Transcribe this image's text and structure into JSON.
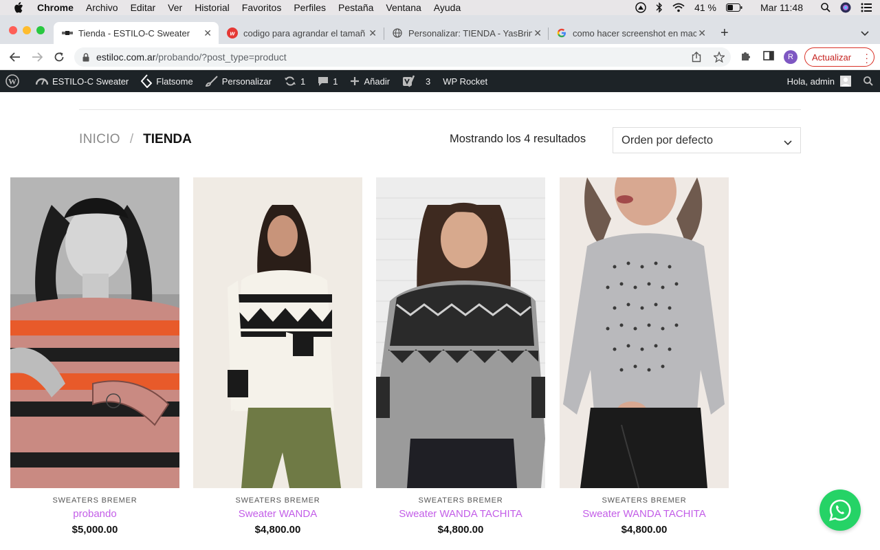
{
  "menubar": {
    "app": "Chrome",
    "items": [
      "Archivo",
      "Editar",
      "Ver",
      "Historial",
      "Favoritos",
      "Perfiles",
      "Pestaña",
      "Ventana",
      "Ayuda"
    ],
    "battery": "41 %",
    "clock": "Mar 11:48"
  },
  "tabs": [
    {
      "title": "Tienda - ESTILO-C Sweater",
      "active": true
    },
    {
      "title": "codigo para agrandar el tamañ",
      "active": false
    },
    {
      "title": "Personalizar: TIENDA - YasBrin",
      "active": false
    },
    {
      "title": "como hacer screenshot en mac",
      "active": false
    }
  ],
  "address": {
    "domain": "estiloc.com.ar",
    "path": "/probando/?post_type=product",
    "update_label": "Actualizar",
    "profile_initial": "R"
  },
  "adminbar": {
    "site": "ESTILO-C Sweater",
    "theme": "Flatsome",
    "customize": "Personalizar",
    "updates": "1",
    "comments": "1",
    "add": "Añadir",
    "yoast": "3",
    "rocket": "WP Rocket",
    "greeting": "Hola, admin"
  },
  "page": {
    "breadcrumb_home": "INICIO",
    "breadcrumb_sep": "/",
    "breadcrumb_current": "TIENDA",
    "results": "Mostrando los 4 resultados",
    "orderby": "Orden por defecto"
  },
  "products": [
    {
      "category": "SWEATERS BREMER",
      "name": "probando",
      "price": "$5,000.00"
    },
    {
      "category": "SWEATERS BREMER",
      "name": "Sweater WANDA",
      "price": "$4,800.00"
    },
    {
      "category": "SWEATERS BREMER",
      "name": "Sweater WANDA TACHITA",
      "price": "$4,800.00"
    },
    {
      "category": "SWEATERS BREMER",
      "name": "Sweater WANDA TACHITA",
      "price": "$4,800.00"
    }
  ],
  "colors": {
    "accent": "#c35de8",
    "adminbar": "#1d2327",
    "whatsapp": "#25d366"
  }
}
